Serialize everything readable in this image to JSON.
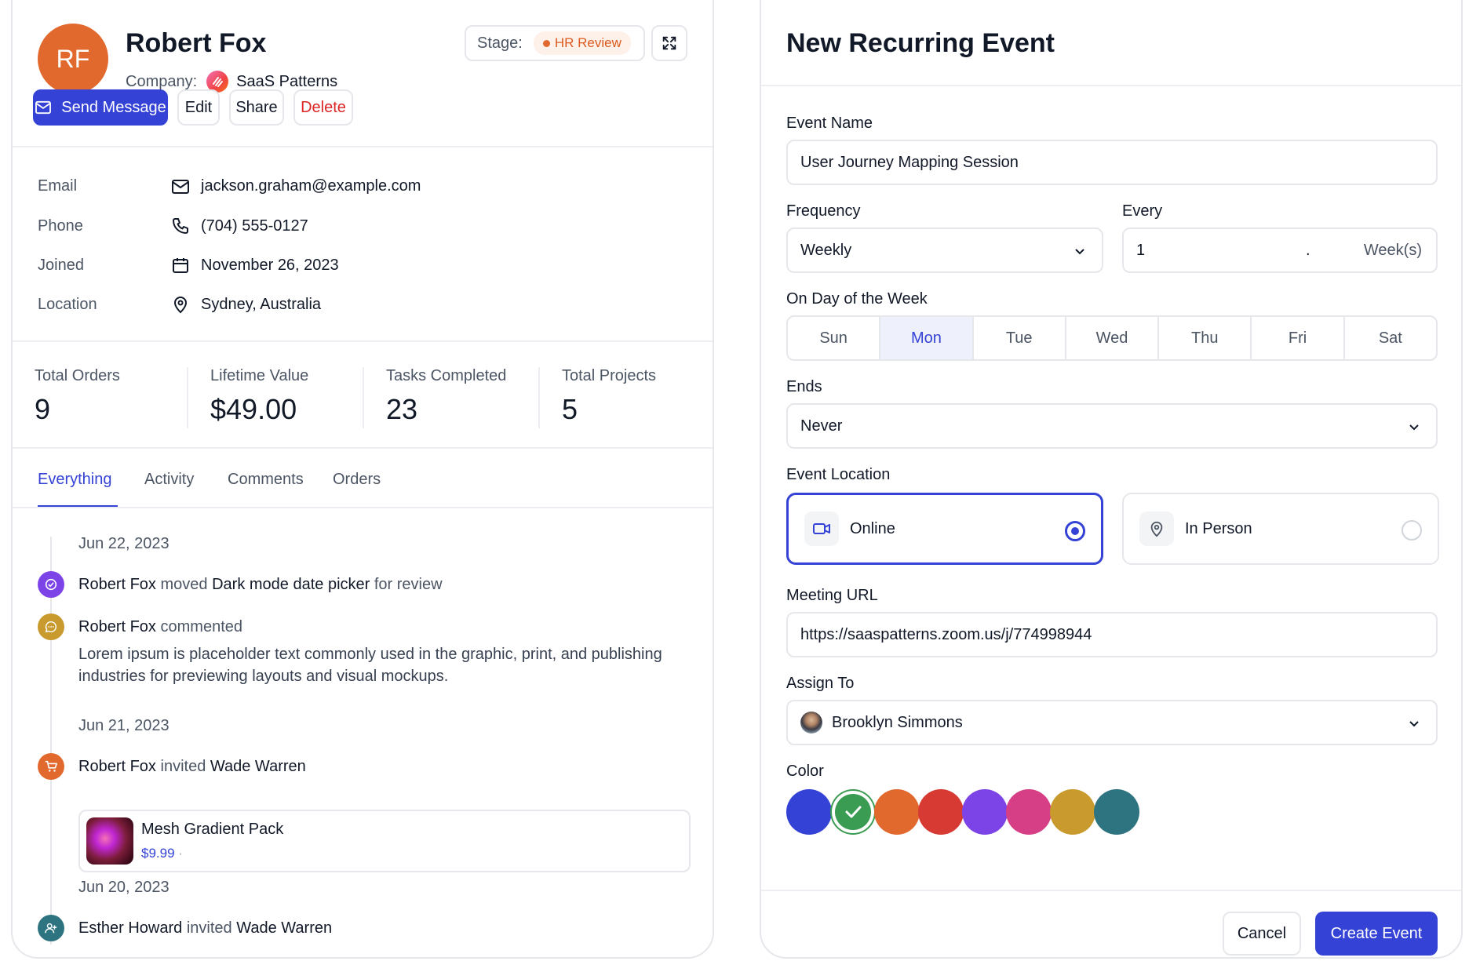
{
  "profile": {
    "initials": "RF",
    "name": "Robert Fox",
    "company_label": "Company:",
    "company_name": "SaaS Patterns",
    "stage_label": "Stage:",
    "stage_value": "HR Review",
    "actions": {
      "send": "Send Message",
      "edit": "Edit",
      "share": "Share",
      "delete": "Delete"
    },
    "info": [
      {
        "label": "Email",
        "icon": "mail-icon",
        "value": "jackson.graham@example.com"
      },
      {
        "label": "Phone",
        "icon": "phone-icon",
        "value": "(704) 555-0127"
      },
      {
        "label": "Joined",
        "icon": "calendar-icon",
        "value": "November 26, 2023"
      },
      {
        "label": "Location",
        "icon": "map-pin-icon",
        "value": "Sydney, Australia"
      }
    ],
    "stats": [
      {
        "label": "Total Orders",
        "value": "9"
      },
      {
        "label": "Lifetime Value",
        "value": "$49.00"
      },
      {
        "label": "Tasks Completed",
        "value": "23"
      },
      {
        "label": "Total Projects",
        "value": "5"
      }
    ],
    "tabs": [
      "Everything",
      "Activity",
      "Comments",
      "Orders"
    ],
    "timeline": {
      "date1": "Jun 22, 2023",
      "ev1": {
        "actor": "Robert Fox",
        "verb": "moved",
        "object": "Dark mode date picker",
        "suffix": "for review"
      },
      "ev2": {
        "actor": "Robert Fox",
        "verb": "commented",
        "body": "Lorem ipsum is placeholder text commonly used in the graphic, print, and publishing industries for previewing layouts and visual mockups."
      },
      "date2": "Jun 21, 2023",
      "ev3": {
        "actor": "Robert Fox",
        "verb": "invited",
        "object": "Wade Warren"
      },
      "product": {
        "name": "Mesh Gradient Pack",
        "price": "$9.99",
        "sep": "·"
      },
      "date3": "Jun 20, 2023",
      "ev4": {
        "actor": "Esther Howard",
        "verb": "invited",
        "object": "Wade Warren"
      }
    }
  },
  "event_form": {
    "title": "New Recurring Event",
    "event_name_label": "Event Name",
    "event_name_value": "User Journey Mapping Session",
    "frequency_label": "Frequency",
    "frequency_value": "Weekly",
    "every_label": "Every",
    "every_value": "1",
    "every_sep": ".",
    "every_unit": "Week(s)",
    "days_label": "On Day of the Week",
    "days": [
      "Sun",
      "Mon",
      "Tue",
      "Wed",
      "Thu",
      "Fri",
      "Sat"
    ],
    "selected_day": "Mon",
    "ends_label": "Ends",
    "ends_value": "Never",
    "location_label": "Event Location",
    "location_online": "Online",
    "location_in_person": "In Person",
    "selected_location": "Online",
    "meeting_url_label": "Meeting URL",
    "meeting_url_value": "https://saaspatterns.zoom.us/j/774998944",
    "assign_label": "Assign To",
    "assign_value": "Brooklyn Simmons",
    "color_label": "Color",
    "colors": [
      "#3442d6",
      "#3a9b52",
      "#e2692e",
      "#d63a32",
      "#7c44e6",
      "#d63f86",
      "#c99a2e",
      "#2e7480"
    ],
    "selected_color": "#3a9b52",
    "cancel": "Cancel",
    "create": "Create Event"
  },
  "accent": "#3442d6"
}
